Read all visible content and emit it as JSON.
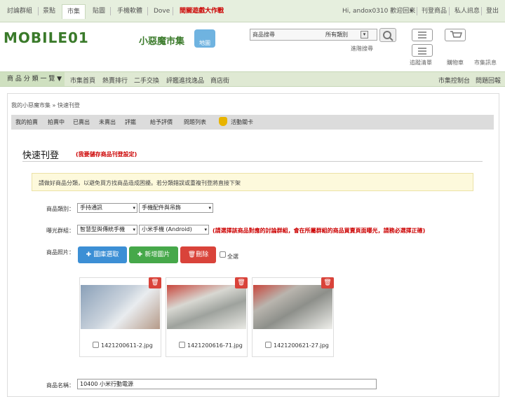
{
  "topnav": {
    "tabs": [
      "討論群組",
      "景點",
      "市集",
      "貼圖",
      "手機軟體",
      "Dove",
      "間關遊戲大作戰"
    ],
    "greeting": "Hi, andox0310 歡迎回來",
    "greeting_arrow": "▾",
    "links": [
      "刊登商品",
      "私人訊息",
      "登出"
    ]
  },
  "header": {
    "logo_text": "MOBILE01",
    "site_name": "小惡魔市集",
    "map_label": "地圖",
    "search_placeholder": "商品搜尋",
    "search_category": "所有類別",
    "advanced_search": "進階搜尋",
    "icon_labels": [
      "追蹤清單",
      "購物車",
      "市集訊息"
    ]
  },
  "menubar": {
    "category_menu": "商 品 分 類 一 覽 ▼",
    "items": [
      "市集首頁",
      "熱賣排行",
      "二手交換",
      "評鑑進找逸品",
      "商店街"
    ],
    "right_items": [
      "市集控制台",
      "問題回報"
    ]
  },
  "breadcrumb": "我的小惡魔市集 » 快速刊登",
  "subnav": [
    "我的拍賣",
    "拍賣中",
    "已賣出",
    "未賣出",
    "評鑑",
    "給予評價",
    "問題列表",
    "活動關卡"
  ],
  "page": {
    "title": "快速刊登",
    "title_note": "(我要儲存商品刊登設定)",
    "notice": "請做好商品分類，以避免買方找商品造成困擾。若分類錯誤或重複刊登將直接下架"
  },
  "form": {
    "category_label": "商品類別：",
    "category_1": "手持通訊",
    "category_2": "手機配件與吊飾",
    "exposure_label": "曝光群組：",
    "exposure_1": "智慧型與傳統手機",
    "exposure_2": "小米手機 (Android)",
    "exposure_warning": "(請選擇該商品對應的討論群組，會在所屬群組的商品買賣頁面曝光，請務必選擇正確)",
    "photo_label": "商品照片：",
    "btn_gallery": "圖庫選取",
    "btn_add": "新增圖片",
    "btn_delete": "刪除",
    "select_all": "全選",
    "photos": [
      "1421200611-2.jpg",
      "1421200616-71.jpg",
      "1421200621-27.jpg"
    ],
    "name_label": "商品名稱：",
    "name_value": "10400 小米行動電源"
  }
}
